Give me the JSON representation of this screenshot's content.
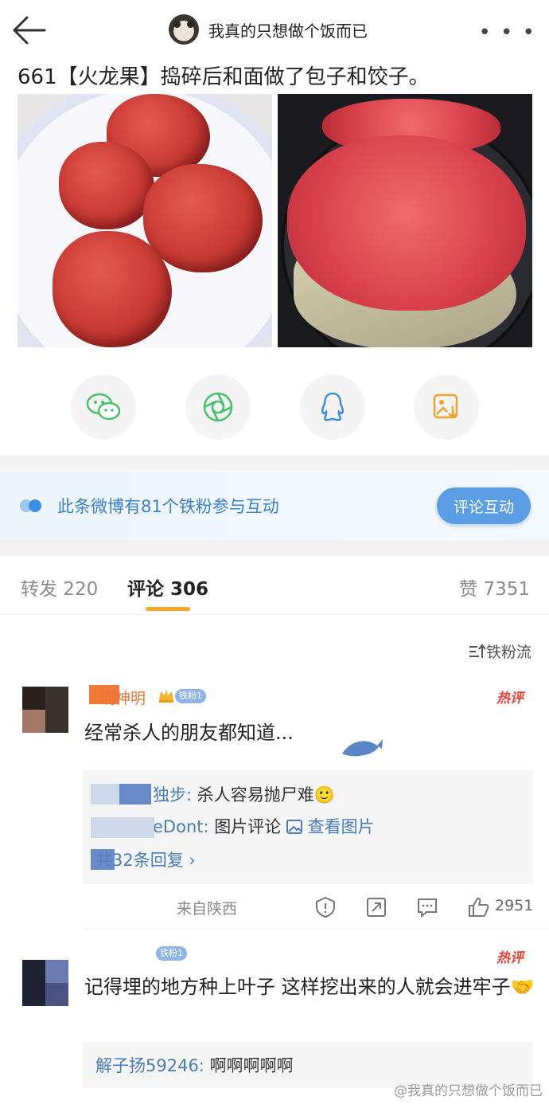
{
  "header": {
    "author_name": "我真的只想做个饭而已",
    "more": "• • •"
  },
  "post": {
    "text": "661【火龙果】捣碎后和面做了包子和饺子。"
  },
  "banner": {
    "text": "此条微博有81个铁粉参与互动",
    "button": "评论互动"
  },
  "tabs": {
    "repost": "转发 220",
    "comment": "评论 306",
    "like": "赞 7351"
  },
  "fanflow": "铁粉流",
  "comments": [
    {
      "name": "明神明",
      "badge": "铁粉1",
      "hot": "热评",
      "text": "经常杀人的朋友都知道...",
      "replies": [
        {
          "who": "独步:",
          "text": "杀人容易抛尸难🙂"
        },
        {
          "who": "eDont:",
          "text": "图片评论",
          "link": "查看图片"
        },
        {
          "more": "共32条回复 ›"
        }
      ],
      "location": "来自陕西",
      "likes": "2951"
    },
    {
      "badge": "铁粉1",
      "hot": "热评",
      "text": "记得埋的地方种上叶子 这样挖出来的人就会进牢子🤝",
      "replies": [
        {
          "who": "解子扬59246:",
          "text": "啊啊啊啊啊"
        }
      ]
    }
  ],
  "watermark": "@我真的只想做个饭而已",
  "colors": {
    "accent_blue": "#5b9ee6",
    "link_blue": "#4a7cba",
    "hot_red": "#e9423a",
    "tab_underline": "#f5a623"
  }
}
